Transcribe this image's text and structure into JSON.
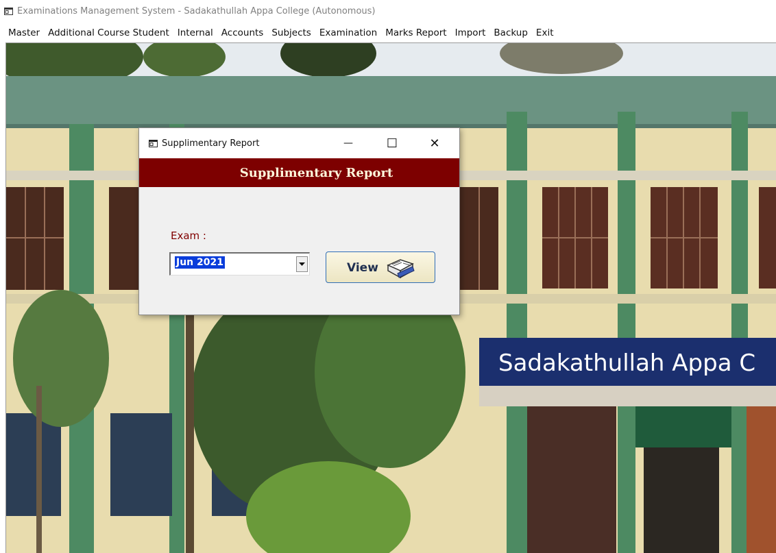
{
  "app": {
    "title": "Examinations Management System - Sadakathullah Appa College (Autonomous)"
  },
  "menu": [
    {
      "label": "Master"
    },
    {
      "label": "Additional Course Student"
    },
    {
      "label": "Internal"
    },
    {
      "label": "Accounts"
    },
    {
      "label": "Subjects"
    },
    {
      "label": "Examination"
    },
    {
      "label": "Marks Report"
    },
    {
      "label": "Import"
    },
    {
      "label": "Backup"
    },
    {
      "label": "Exit"
    }
  ],
  "background": {
    "sign_text": "Sadakathullah Appa C"
  },
  "dialog": {
    "title": "Supplimentary Report",
    "banner": "Supplimentary Report",
    "exam_label": "Exam :",
    "exam_value": "Jun 2021",
    "view_label": "View",
    "minimize_glyph": "—",
    "maximize_glyph": "☐",
    "close_glyph": "✕"
  },
  "colors": {
    "banner": "#7d0000",
    "label": "#800000",
    "selection": "#0a3ddb"
  },
  "icons": {
    "app": "window-icon",
    "view": "open-book-icon"
  }
}
